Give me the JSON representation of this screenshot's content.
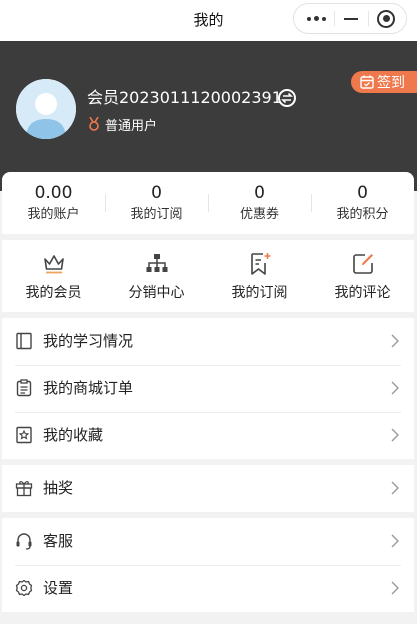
{
  "titlebar": {
    "title": "我的"
  },
  "profile": {
    "username": "会员2023011120002391",
    "user_type": "普通用户",
    "checkin_label": "签到"
  },
  "stats": [
    {
      "value": "0.00",
      "label": "我的账户"
    },
    {
      "value": "0",
      "label": "我的订阅"
    },
    {
      "value": "0",
      "label": "优惠券"
    },
    {
      "value": "0",
      "label": "我的积分"
    }
  ],
  "shortcuts": [
    {
      "label": "我的会员",
      "icon": "crown-icon"
    },
    {
      "label": "分销中心",
      "icon": "org-chart-icon"
    },
    {
      "label": "我的订阅",
      "icon": "bookmark-icon"
    },
    {
      "label": "我的评论",
      "icon": "edit-icon"
    }
  ],
  "menu": {
    "group1": [
      {
        "label": "我的学习情况",
        "icon": "book-icon"
      },
      {
        "label": "我的商城订单",
        "icon": "clipboard-icon"
      },
      {
        "label": "我的收藏",
        "icon": "favorite-icon"
      }
    ],
    "group2": [
      {
        "label": "抽奖",
        "icon": "gift-icon"
      }
    ],
    "group3": [
      {
        "label": "客服",
        "icon": "headset-icon"
      },
      {
        "label": "设置",
        "icon": "gear-icon"
      }
    ]
  },
  "colors": {
    "header_bg": "#3c3c3c",
    "accent": "#f0784d",
    "icon_gray": "#444444"
  }
}
